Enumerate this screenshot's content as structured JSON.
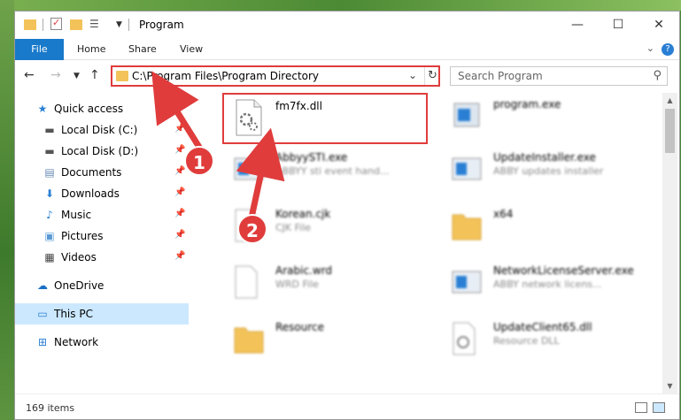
{
  "window": {
    "title": "Program"
  },
  "ribbon": {
    "tabs": [
      "File",
      "Home",
      "Share",
      "View"
    ]
  },
  "nav": {
    "address": "C:\\Program Files\\Program Directory",
    "search_placeholder": "Search Program"
  },
  "sidebar": {
    "items": [
      {
        "label": "Quick access",
        "icon": "star-icon"
      },
      {
        "label": "Local Disk (C:)",
        "icon": "drive-icon",
        "pinned": true
      },
      {
        "label": "Local Disk (D:)",
        "icon": "drive-icon",
        "pinned": true
      },
      {
        "label": "Documents",
        "icon": "documents-icon",
        "pinned": true
      },
      {
        "label": "Downloads",
        "icon": "download-icon",
        "pinned": true
      },
      {
        "label": "Music",
        "icon": "music-icon",
        "pinned": true
      },
      {
        "label": "Pictures",
        "icon": "pictures-icon",
        "pinned": true
      },
      {
        "label": "Videos",
        "icon": "videos-icon",
        "pinned": true
      },
      {
        "label": "OneDrive",
        "icon": "cloud-icon"
      },
      {
        "label": "This PC",
        "icon": "computer-icon",
        "selected": true
      },
      {
        "label": "Network",
        "icon": "network-icon"
      }
    ]
  },
  "files": [
    {
      "name": "fm7fx.dll",
      "desc": ""
    },
    {
      "name": "program.exe",
      "desc": ""
    },
    {
      "name": "AbbyySTI.exe",
      "desc": "ABBYY sti event hand..."
    },
    {
      "name": "UpdateInstaller.exe",
      "desc": "ABBY updates installer"
    },
    {
      "name": "Korean.cjk",
      "desc": "CJK File"
    },
    {
      "name": "x64",
      "desc": ""
    },
    {
      "name": "Arabic.wrd",
      "desc": "WRD File"
    },
    {
      "name": "NetworkLicenseServer.exe",
      "desc": "ABBY network licens..."
    },
    {
      "name": "Resource",
      "desc": ""
    },
    {
      "name": "UpdateClient65.dll",
      "desc": "Resource DLL"
    }
  ],
  "status": {
    "items_count": "169 items"
  },
  "callouts": [
    "1",
    "2"
  ],
  "colors": {
    "accent": "#1979ca",
    "highlight": "#e03c3c",
    "selection": "#cce8ff"
  }
}
